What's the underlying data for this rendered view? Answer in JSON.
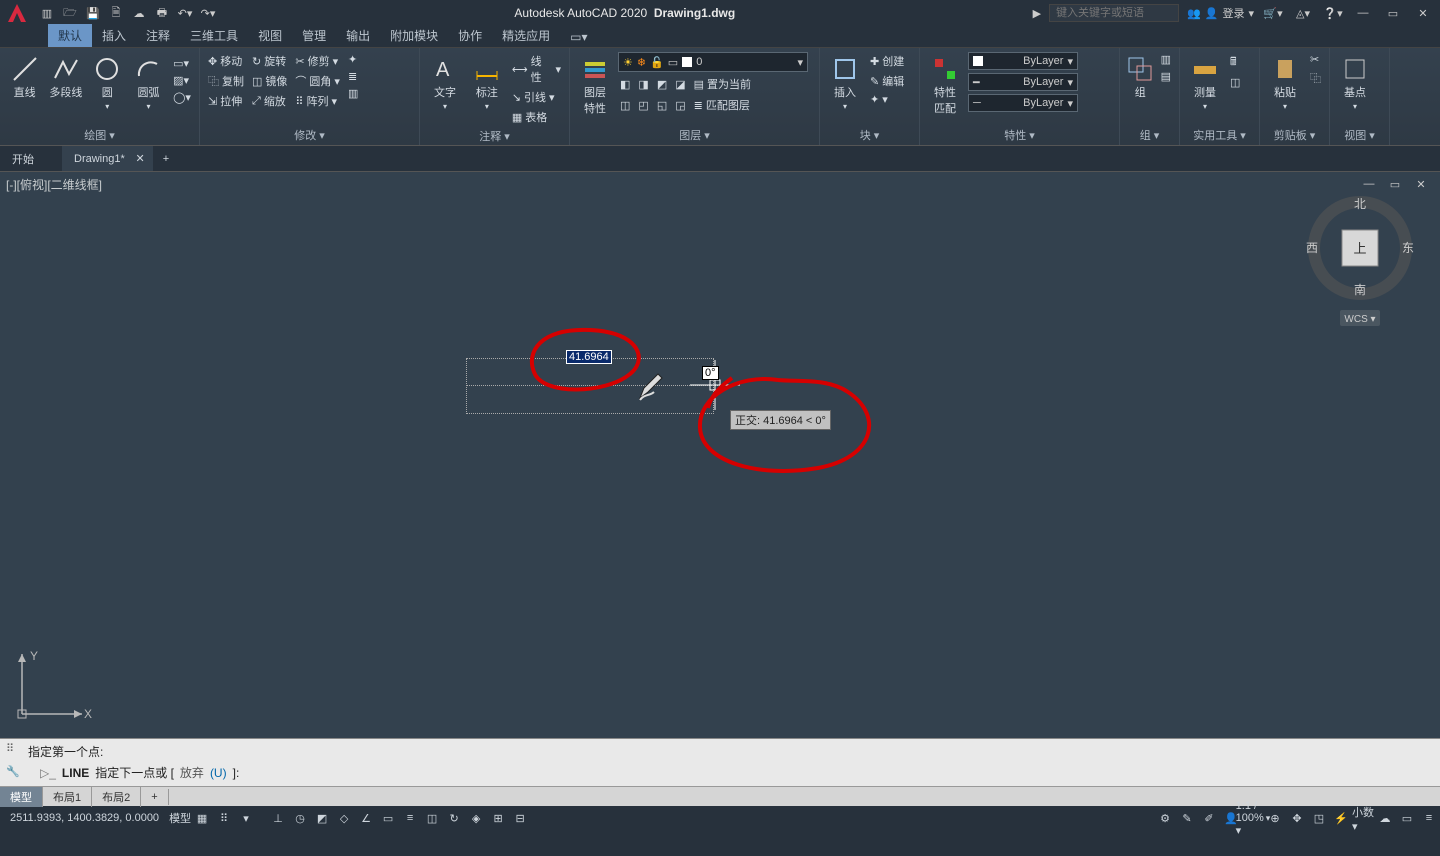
{
  "title": {
    "app": "Autodesk AutoCAD 2020",
    "file": "Drawing1.dwg"
  },
  "search_placeholder": "键入关键字或短语",
  "login_label": "登录",
  "menu": {
    "tabs": [
      "默认",
      "插入",
      "注释",
      "三维工具",
      "视图",
      "管理",
      "输出",
      "附加模块",
      "协作",
      "精选应用"
    ],
    "active": "默认"
  },
  "ribbon": {
    "draw": {
      "title": "绘图 ▾",
      "line": "直线",
      "polyline": "多段线",
      "circle": "圆",
      "arc": "圆弧"
    },
    "modify": {
      "title": "修改 ▾",
      "move": "移动",
      "copy": "复制",
      "stretch": "拉伸",
      "rotate": "旋转",
      "mirror": "镜像",
      "scale": "缩放",
      "trim": "修剪",
      "fillet": "圆角",
      "array": "阵列"
    },
    "anno": {
      "title": "注释 ▾",
      "text": "文字",
      "dim": "标注",
      "linetype": "线性",
      "leader": "引线",
      "table": "表格"
    },
    "layer": {
      "title": "图层 ▾",
      "props": "图层\n特性",
      "current": "置为当前",
      "match": "匹配图层",
      "combo": "0"
    },
    "block": {
      "title": "块 ▾",
      "insert": "插入",
      "create": "创建",
      "edit": "编辑"
    },
    "props": {
      "title": "特性 ▾",
      "match": "特性\n匹配",
      "bylayer": "ByLayer"
    },
    "group": {
      "title": "组 ▾",
      "label": "组"
    },
    "util": {
      "title": "实用工具 ▾",
      "measure": "测量"
    },
    "clip": {
      "title": "剪贴板 ▾",
      "paste": "粘贴"
    },
    "view": {
      "title": "视图 ▾",
      "base": "基点"
    }
  },
  "doctabs": {
    "home": "开始",
    "current": "Drawing1*",
    "add": "+"
  },
  "viewport": {
    "label": "[-][俯视][二维线框]",
    "north": "北",
    "south": "南",
    "east": "东",
    "west": "西",
    "top": "上",
    "wcs": "WCS ▾",
    "dyn_len": "41.6964",
    "dyn_ang": "0°",
    "tooltip": "正交: 41.6964 < 0°",
    "y": "Y",
    "x": "X"
  },
  "cmd": {
    "line1": "指定第一个点:",
    "prefix": "LINE",
    "body": "指定下一点或 [",
    "opt": "放弃",
    "key": "(U)",
    "tail": "]:"
  },
  "layouts": {
    "model": "模型",
    "l1": "布局1",
    "l2": "布局2",
    "add": "+"
  },
  "status": {
    "coord": "2511.9393, 1400.3829, 0.0000",
    "model": "模型",
    "scale": "1:1 / 100% ▾",
    "dec": "小数 ▾"
  }
}
